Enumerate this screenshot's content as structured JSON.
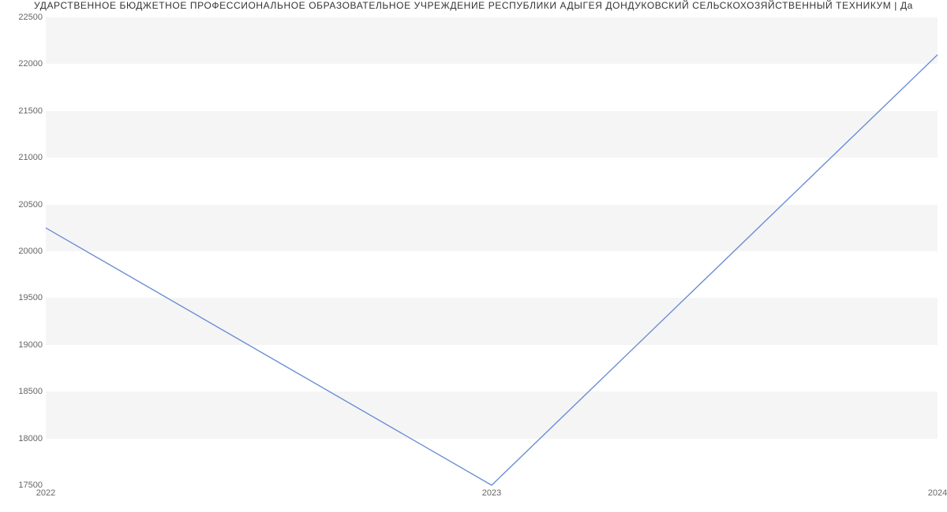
{
  "chart_data": {
    "type": "line",
    "title": "УДАРСТВЕННОЕ БЮДЖЕТНОЕ ПРОФЕССИОНАЛЬНОЕ ОБРАЗОВАТЕЛЬНОЕ УЧРЕЖДЕНИЕ РЕСПУБЛИКИ АДЫГЕЯ ДОНДУКОВСКИЙ СЕЛЬСКОХОЗЯЙСТВЕННЫЙ ТЕХНИКУМ | Да",
    "x": [
      2022,
      2023,
      2024
    ],
    "values": [
      20250,
      17500,
      22100
    ],
    "xlabel": "",
    "ylabel": "",
    "xlim": [
      2022,
      2024
    ],
    "ylim": [
      17500,
      22500
    ],
    "yticks": [
      17500,
      18000,
      18500,
      19000,
      19500,
      20000,
      20500,
      21000,
      21500,
      22000,
      22500
    ],
    "xticks": [
      2022,
      2023,
      2024
    ],
    "line_color": "#6b8fd4"
  }
}
